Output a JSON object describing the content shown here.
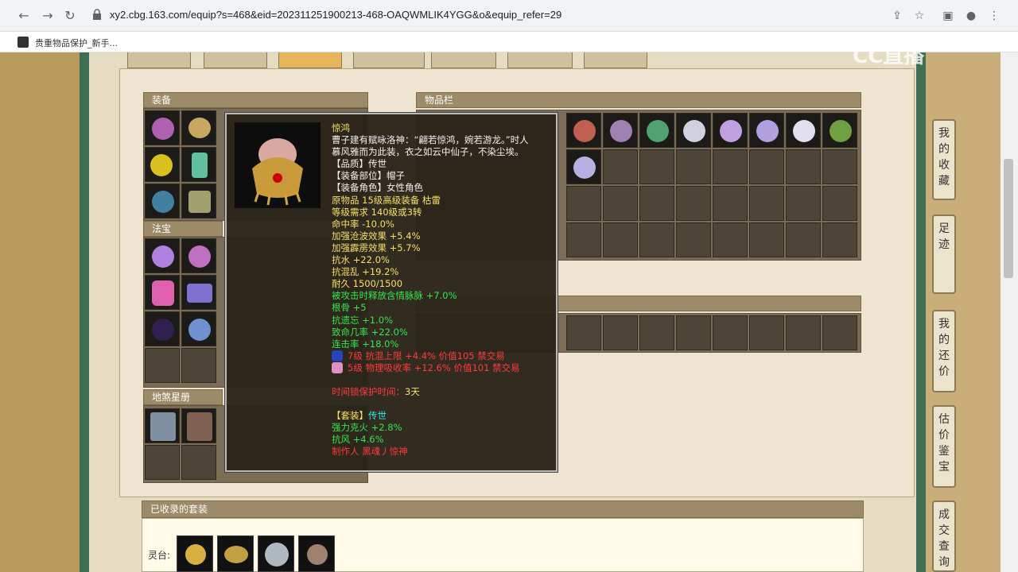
{
  "browser": {
    "url": "xy2.cbg.163.com/equip?s=468&eid=202311251900213-468-OAQWMLIK4YGG&o&equip_refer=29",
    "bookmark": "贵重物品保护_新手..."
  },
  "watermark": "CC直播",
  "panels": {
    "equip_title": "装备",
    "fabao_title": "法宝",
    "dishen_title": "地煞星册",
    "inventory_title": "物品栏"
  },
  "tooltip": {
    "name": "惊鸿",
    "desc_line1": "曹子建有赋咏洛神：“翩若惊鸿，婉若游龙。”时人",
    "desc_line2": "慕风雅而为此装，衣之如云中仙子，不染尘埃。",
    "quality": "【品质】传世",
    "slot": "【装备部位】帽子",
    "role": "【装备角色】女性角色",
    "origin": "原物品 15级高级装备 枯雷",
    "requirement": "等级需求 140级或3转",
    "stat_hit": "命中率 -10.0%",
    "stat_1": "加强沧波效果 +5.4%",
    "stat_2": "加强霹雳效果 +5.7%",
    "stat_3": "抗水 +22.0%",
    "stat_4": "抗混乱 +19.2%",
    "durability": "耐久 1500/1500",
    "bonus_1": "被攻击时释放含情脉脉 +7.0%",
    "bonus_2": "根骨 +5",
    "bonus_3": "抗遗忘 +1.0%",
    "bonus_4": "致命几率 +22.0%",
    "bonus_5": "连击率 +18.0%",
    "gem_1": "7级 抗混上限 +4.4% 价值105 禁交易",
    "gem_2": "5级 物理吸收率 +12.6% 价值101 禁交易",
    "protect_label": "时间锁保护时间：",
    "protect_value": "3天",
    "suit": "【套装】",
    "suit_name": "传世",
    "suit_1": "强力克火 +2.8%",
    "suit_2": "抗风 +4.6%",
    "maker": "制作人 黑魂丿惊神"
  },
  "suit_section": {
    "title": "已收录的套装",
    "label": "灵台:"
  },
  "side_buttons": [
    "我的收藏",
    "足迹",
    "我的还价",
    "估价鉴宝",
    "成交查询"
  ]
}
